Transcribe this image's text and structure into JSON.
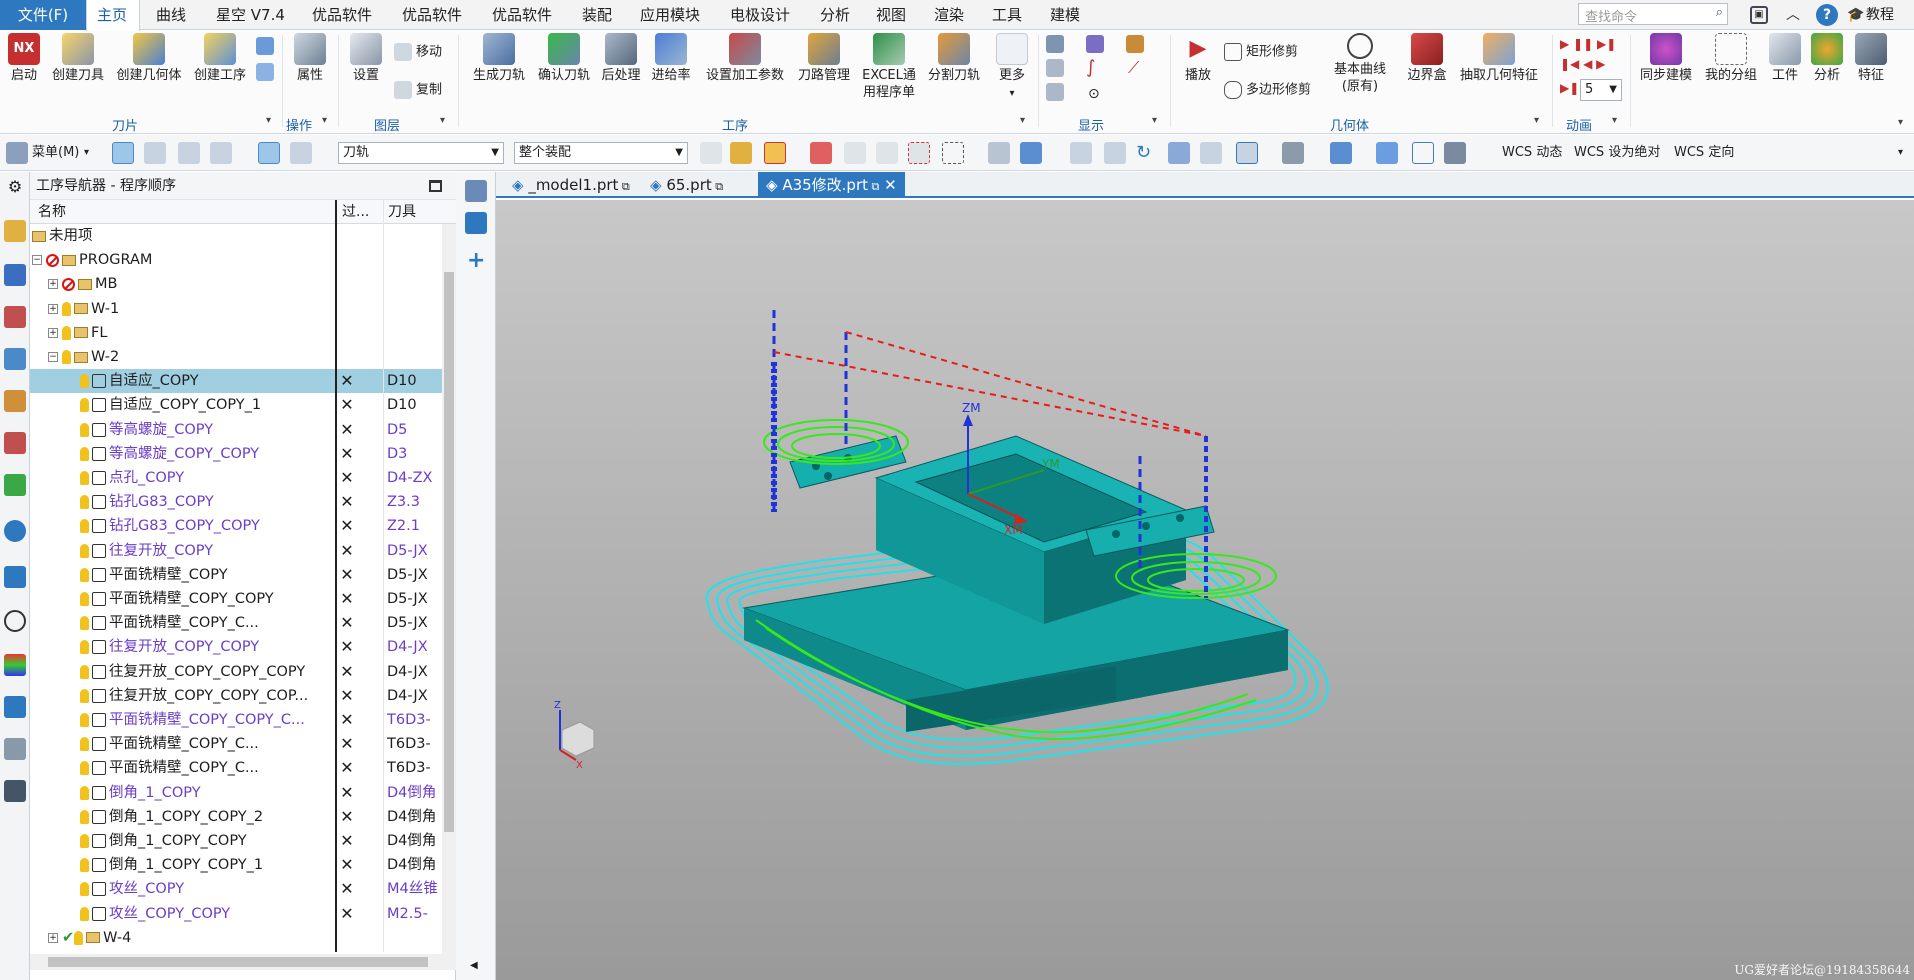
{
  "menu": {
    "items": [
      "文件(F)",
      "主页",
      "曲线",
      "星空 V7.4",
      "优品软件",
      "优品软件",
      "优品软件",
      "装配",
      "应用模块",
      "电极设计",
      "分析",
      "视图",
      "渲染",
      "工具",
      "建模"
    ],
    "search_placeholder": "查找命令",
    "tutorial": "教程"
  },
  "ribbon": {
    "blade": {
      "buttons": [
        "启动",
        "创建刀具",
        "创建几何体",
        "创建工序"
      ],
      "label": "刀片"
    },
    "operation": {
      "buttons": [
        "属性"
      ],
      "label": "操作"
    },
    "layer": {
      "buttons": [
        "设置"
      ],
      "small": [
        "移动",
        "复制"
      ],
      "label": "图层"
    },
    "process": {
      "buttons": [
        "生成刀轨",
        "确认刀轨",
        "后处理",
        "进给率",
        "设置加工参数",
        "刀路管理",
        "EXCEL通",
        "分割刀轨",
        "更多"
      ],
      "excel_line2": "用程序单",
      "label": "工序"
    },
    "display": {
      "label": "显示"
    },
    "geometry": {
      "play": "播放",
      "small": [
        "矩形修剪",
        "多边形修剪"
      ],
      "buttons": [
        "基本曲线",
        "边界盒",
        "抽取几何特征"
      ],
      "basic_curve_line2": "(原有)",
      "label": "几何体"
    },
    "animation": {
      "label": "动画",
      "speed": "5"
    },
    "right": {
      "buttons": [
        "同步建模",
        "我的分组",
        "工件",
        "分析",
        "特征"
      ]
    }
  },
  "toolbar2": {
    "menu_label": "菜单(M)",
    "filter": "刀轨",
    "scope": "整个装配",
    "wcs": [
      "WCS 动态",
      "WCS 设为绝对",
      "WCS 定向"
    ]
  },
  "navigator": {
    "title": "工序导航器 - 程序顺序",
    "columns": [
      "名称",
      "过...",
      "刀具"
    ],
    "rows": [
      {
        "depth": 0,
        "kind": "folder",
        "name": "未用项",
        "x": "",
        "tool": "",
        "purple": false,
        "exp": ""
      },
      {
        "depth": 0,
        "kind": "no",
        "name": "PROGRAM",
        "x": "",
        "tool": "",
        "purple": false,
        "exp": "−"
      },
      {
        "depth": 1,
        "kind": "no",
        "name": "MB",
        "x": "",
        "tool": "",
        "purple": false,
        "exp": "+"
      },
      {
        "depth": 1,
        "kind": "bulb",
        "name": "W-1",
        "x": "",
        "tool": "",
        "purple": false,
        "exp": "+"
      },
      {
        "depth": 1,
        "kind": "bulb",
        "name": "FL",
        "x": "",
        "tool": "",
        "purple": false,
        "exp": "+"
      },
      {
        "depth": 1,
        "kind": "bulb",
        "name": "W-2",
        "x": "",
        "tool": "",
        "purple": false,
        "exp": "−"
      },
      {
        "depth": 2,
        "kind": "op",
        "name": "自适应_COPY",
        "x": "✕",
        "tool": "D10",
        "purple": false,
        "sel": true
      },
      {
        "depth": 2,
        "kind": "op",
        "name": "自适应_COPY_COPY_1",
        "x": "✕",
        "tool": "D10",
        "purple": false
      },
      {
        "depth": 2,
        "kind": "op",
        "name": "等高螺旋_COPY",
        "x": "✕",
        "tool": "D5",
        "purple": true
      },
      {
        "depth": 2,
        "kind": "op",
        "name": "等高螺旋_COPY_COPY",
        "x": "✕",
        "tool": "D3",
        "purple": true
      },
      {
        "depth": 2,
        "kind": "op",
        "name": "点孔_COPY",
        "x": "✕",
        "tool": "D4-ZX",
        "purple": true
      },
      {
        "depth": 2,
        "kind": "op",
        "name": "钻孔G83_COPY",
        "x": "✕",
        "tool": "Z3.3",
        "purple": true
      },
      {
        "depth": 2,
        "kind": "op",
        "name": "钻孔G83_COPY_COPY",
        "x": "✕",
        "tool": "Z2.1",
        "purple": true
      },
      {
        "depth": 2,
        "kind": "op",
        "name": "往复开放_COPY",
        "x": "✕",
        "tool": "D5-JX",
        "purple": true
      },
      {
        "depth": 2,
        "kind": "op",
        "name": "平面铣精壁_COPY",
        "x": "✕",
        "tool": "D5-JX",
        "purple": false
      },
      {
        "depth": 2,
        "kind": "op",
        "name": "平面铣精壁_COPY_COPY",
        "x": "✕",
        "tool": "D5-JX",
        "purple": false
      },
      {
        "depth": 2,
        "kind": "op",
        "name": "平面铣精壁_COPY_C...",
        "x": "✕",
        "tool": "D5-JX",
        "purple": false
      },
      {
        "depth": 2,
        "kind": "op",
        "name": "往复开放_COPY_COPY",
        "x": "✕",
        "tool": "D4-JX",
        "purple": true
      },
      {
        "depth": 2,
        "kind": "op",
        "name": "往复开放_COPY_COPY_COPY",
        "x": "✕",
        "tool": "D4-JX",
        "purple": false
      },
      {
        "depth": 2,
        "kind": "op",
        "name": "往复开放_COPY_COPY_COP...",
        "x": "✕",
        "tool": "D4-JX",
        "purple": false
      },
      {
        "depth": 2,
        "kind": "op",
        "name": "平面铣精壁_COPY_COPY_C...",
        "x": "✕",
        "tool": "T6D3-",
        "purple": true
      },
      {
        "depth": 2,
        "kind": "op",
        "name": "平面铣精壁_COPY_C...",
        "x": "✕",
        "tool": "T6D3-",
        "purple": false
      },
      {
        "depth": 2,
        "kind": "op",
        "name": "平面铣精壁_COPY_C...",
        "x": "✕",
        "tool": "T6D3-",
        "purple": false
      },
      {
        "depth": 2,
        "kind": "op",
        "name": "倒角_1_COPY",
        "x": "✕",
        "tool": "D4倒角",
        "purple": true
      },
      {
        "depth": 2,
        "kind": "op",
        "name": "倒角_1_COPY_COPY_2",
        "x": "✕",
        "tool": "D4倒角",
        "purple": false
      },
      {
        "depth": 2,
        "kind": "op",
        "name": "倒角_1_COPY_COPY",
        "x": "✕",
        "tool": "D4倒角",
        "purple": false
      },
      {
        "depth": 2,
        "kind": "op",
        "name": "倒角_1_COPY_COPY_1",
        "x": "✕",
        "tool": "D4倒角",
        "purple": false
      },
      {
        "depth": 2,
        "kind": "op",
        "name": "攻丝_COPY",
        "x": "✕",
        "tool": "M4丝锥",
        "purple": true
      },
      {
        "depth": 2,
        "kind": "op",
        "name": "攻丝_COPY_COPY",
        "x": "✕",
        "tool": "M2.5-",
        "purple": true
      },
      {
        "depth": 1,
        "kind": "check",
        "name": "W-4",
        "x": "",
        "tool": "",
        "purple": false,
        "exp": "+"
      }
    ]
  },
  "tabs": [
    {
      "label": "_model1.prt",
      "active": false
    },
    {
      "label": "65.prt",
      "active": false
    },
    {
      "label": "A35修改.prt",
      "active": true
    }
  ],
  "viewport": {
    "axis_labels": [
      "ZM",
      "YM",
      "XM"
    ],
    "triad_labels": [
      "Z",
      "X"
    ],
    "watermark": "UG爱好者论坛@19184358644"
  },
  "colors": {
    "accent": "#2e78bf",
    "part": "#108c8c",
    "toolpath_cyan": "#1fe3e8",
    "toolpath_green": "#38e81a"
  }
}
